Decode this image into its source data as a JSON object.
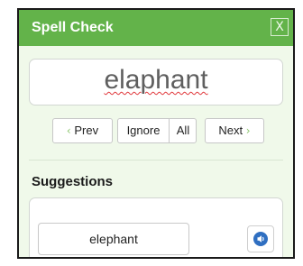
{
  "dialog": {
    "title": "Spell Check",
    "close_label": "X"
  },
  "word": {
    "text": "elaphant",
    "misspelled": true
  },
  "nav": {
    "prev_label": "Prev",
    "ignore_label": "Ignore",
    "all_label": "All",
    "next_label": "Next"
  },
  "suggestions": {
    "heading": "Suggestions",
    "items": [
      {
        "label": "elephant",
        "icon": "speaker-icon"
      }
    ]
  },
  "colors": {
    "title_bar": "#63b34a",
    "body_bg": "#f0f9ea",
    "accent_chevron": "#8cc66e",
    "misspell_underline": "#e0363a",
    "speaker_icon": "#2f6fc1"
  }
}
